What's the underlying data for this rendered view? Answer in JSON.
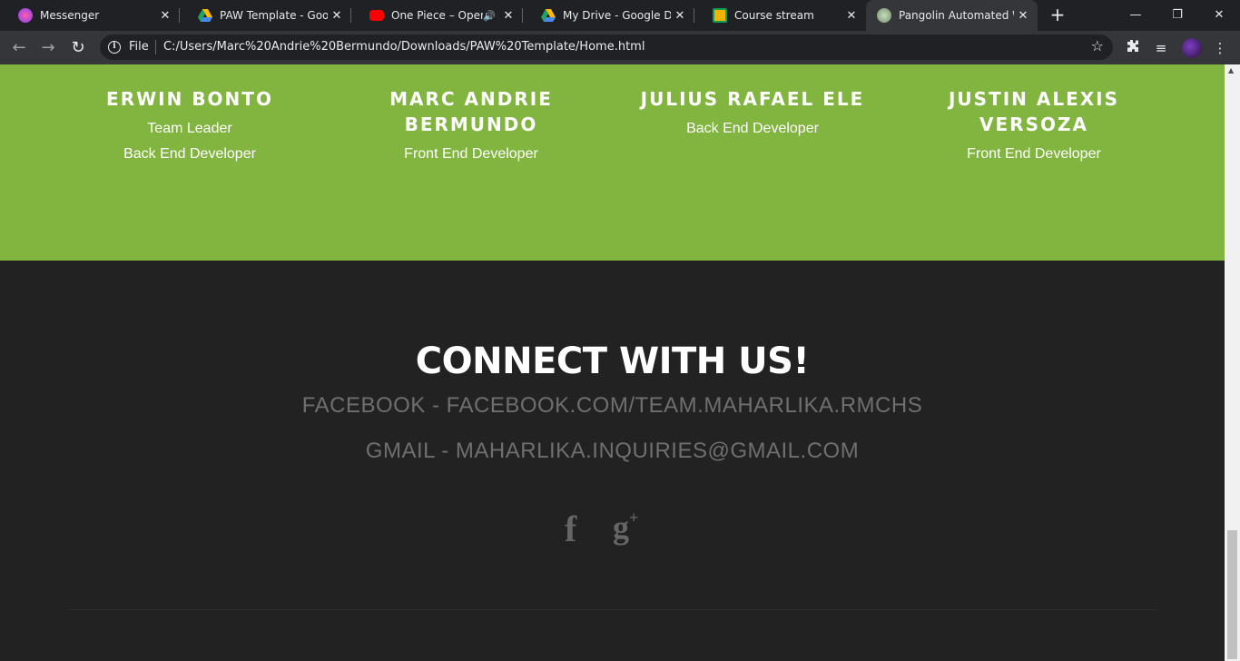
{
  "browser": {
    "tabs": [
      {
        "title": "Messenger",
        "favicon": "messenger-icon",
        "color": "#a33bff"
      },
      {
        "title": "PAW Template - Google",
        "favicon": "google-drive-icon",
        "color": "#1fa463"
      },
      {
        "title": "One Piece – Openin",
        "favicon": "youtube-icon",
        "color": "#ff0000",
        "audio": "🔊"
      },
      {
        "title": "My Drive - Google Drive",
        "favicon": "google-drive-icon",
        "color": "#1fa463"
      },
      {
        "title": "Course stream",
        "favicon": "google-classroom-icon",
        "color": "#f5b400"
      },
      {
        "title": "Pangolin Automated W",
        "favicon": "pangolin-icon",
        "color": "#8fb38a"
      }
    ],
    "scheme": "File",
    "url": "C:/Users/Marc%20Andrie%20Bermundo/Downloads/PAW%20Template/Home.html"
  },
  "team": {
    "members": [
      {
        "name": "ERWIN BONTO",
        "roles": [
          "Team Leader",
          "Back End Developer"
        ]
      },
      {
        "name": "MARC ANDRIE BERMUNDO",
        "roles": [
          "Front End Developer"
        ]
      },
      {
        "name": "JULIUS RAFAEL ELE",
        "roles": [
          "Back End Developer"
        ]
      },
      {
        "name": "JUSTIN ALEXIS VERSOZA",
        "roles": [
          "Front End Developer"
        ]
      }
    ]
  },
  "connect": {
    "heading": "CONNECT WITH US!",
    "facebook": "FACEBOOK - FACEBOOK.COM/TEAM.MAHARLIKA.RMCHS",
    "gmail": "GMAIL - MAHARLIKA.INQUIRIES@GMAIL.COM",
    "social_icons": [
      "facebook-icon",
      "google-plus-icon"
    ]
  },
  "colors": {
    "team_bg": "#82b440",
    "footer_bg": "#222222",
    "contact_text": "#6f6f6f"
  }
}
